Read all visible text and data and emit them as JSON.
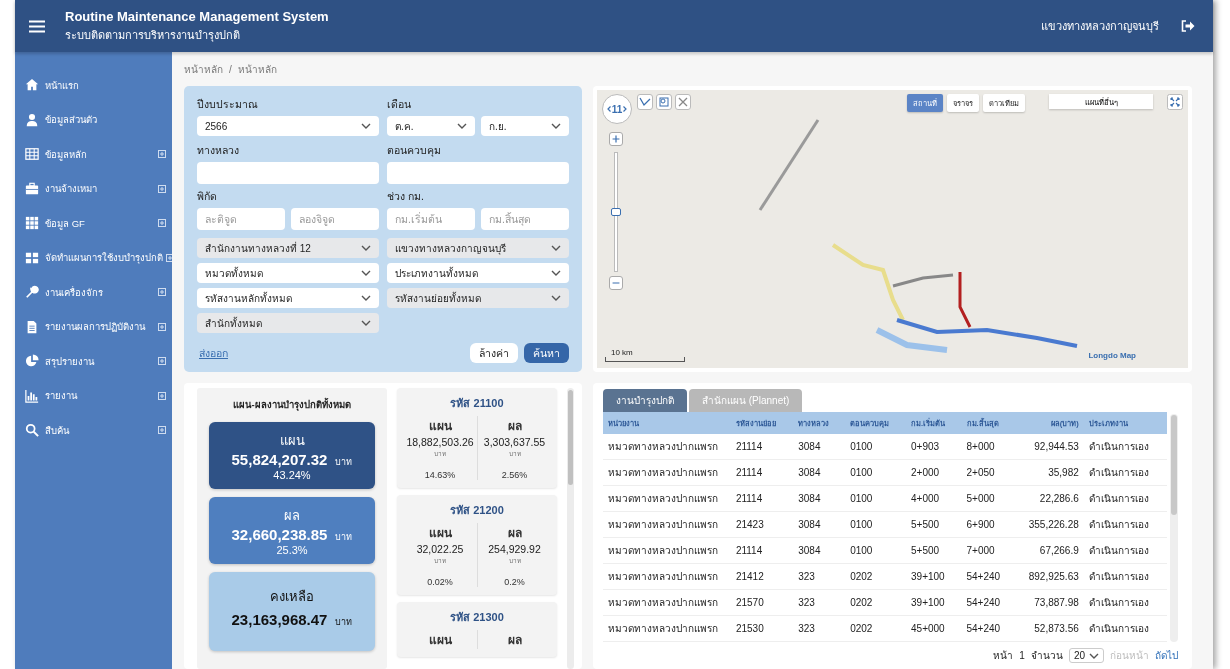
{
  "header": {
    "title": "Routine Maintenance Management System",
    "subtitle": "ระบบติดตามการบริหารงานบำรุงปกติ",
    "user": "แขวงทางหลวงกาญจนบุรี"
  },
  "sidebar": {
    "items": [
      {
        "label": "หน้าแรก",
        "expandable": false
      },
      {
        "label": "ข้อมูลส่วนตัว",
        "expandable": false
      },
      {
        "label": "ข้อมูลหลัก",
        "expandable": true
      },
      {
        "label": "งานจ้างเหมา",
        "expandable": true
      },
      {
        "label": "ข้อมูล GF",
        "expandable": true
      },
      {
        "label": "จัดทำแผนการใช้งบบำรุงปกติ",
        "expandable": true
      },
      {
        "label": "งานเครื่องจักร",
        "expandable": true
      },
      {
        "label": "รายงานผลการปฏิบัติงาน",
        "expandable": true
      },
      {
        "label": "สรุปรายงาน",
        "expandable": true
      },
      {
        "label": "รายงาน",
        "expandable": true
      },
      {
        "label": "สืบค้น",
        "expandable": true
      }
    ]
  },
  "breadcrumb": {
    "items": [
      "หน้าหลัก",
      "หน้าหลัก"
    ],
    "separator": "/"
  },
  "filters": {
    "budget_year": {
      "label": "ปีงบประมาณ",
      "value": "2566"
    },
    "month": {
      "label": "เดือน",
      "from": "ต.ค.",
      "to": "ก.ย."
    },
    "highway": {
      "label": "ทางหลวง"
    },
    "control_section": {
      "label": "ตอนควบคุม"
    },
    "coordinates": {
      "label": "พิกัด",
      "latitude_placeholder": "ละติจูด",
      "longitude_placeholder": "ลองจิจูด"
    },
    "km_range": {
      "label": "ช่วง กม.",
      "start_placeholder": "กม.เริ่มต้น",
      "end_placeholder": "กม.สิ้นสุด"
    },
    "selects": [
      {
        "value": "สำนักงานทางหลวงที่ 12",
        "disabled": true
      },
      {
        "value": "แขวงทางหลวงกาญจนบุรี",
        "disabled": true
      },
      {
        "value": "หมวดทั้งหมด",
        "disabled": false
      },
      {
        "value": "ประเภทงานทั้งหมด",
        "disabled": false
      },
      {
        "value": "รหัสงานหลักทั้งหมด",
        "disabled": false
      },
      {
        "value": "รหัสงานย่อยทั้งหมด",
        "disabled": true
      },
      {
        "value": "สำนักทั้งหมด",
        "disabled": true
      }
    ],
    "export_link": "ส่งออก",
    "clear_button": "ล้างค่า",
    "search_button": "ค้นหา"
  },
  "map": {
    "zoom_level": "11",
    "zoom_slider": {
      "level": 0.5
    },
    "layers": [
      {
        "label": "สถานที่",
        "selected": true
      },
      {
        "label": "จราจร",
        "selected": false
      },
      {
        "label": "ดาวเทียม",
        "selected": false
      }
    ],
    "basemap": "แผนที่อื่นๆ",
    "scale": "10 km",
    "attribution": "Longdo Map"
  },
  "summary": {
    "title": "แผน-ผลงานบำรุงปกติทั้งหมด",
    "cards": [
      {
        "kind": "plan",
        "label": "แผน",
        "amount": "55,824,207.32",
        "unit": "บาท",
        "percent": "43.24%"
      },
      {
        "kind": "result",
        "label": "ผล",
        "amount": "32,660,238.85",
        "unit": "บาท",
        "percent": "25.3%"
      },
      {
        "kind": "remaining",
        "label": "คงเหลือ",
        "amount": "23,163,968.47",
        "unit": "บาท"
      }
    ]
  },
  "code_cards": [
    {
      "title": "รหัส 21100",
      "plan": {
        "label": "แผน",
        "amount": "18,882,503.26",
        "unit": "บาท",
        "percent": "14.63%"
      },
      "result": {
        "label": "ผล",
        "amount": "3,303,637.55",
        "unit": "บาท",
        "percent": "2.56%"
      }
    },
    {
      "title": "รหัส 21200",
      "plan": {
        "label": "แผน",
        "amount": "32,022.25",
        "unit": "บาท",
        "percent": "0.02%"
      },
      "result": {
        "label": "ผล",
        "amount": "254,929.92",
        "unit": "บาท",
        "percent": "0.2%"
      }
    },
    {
      "title": "รหัส 21300",
      "plan": {
        "label": "แผน"
      },
      "result": {
        "label": "ผล"
      }
    }
  ],
  "tabs": [
    {
      "label": "งานบำรุงปกติ",
      "selected": true
    },
    {
      "label": "สำนักแผน (Plannet)",
      "selected": false
    }
  ],
  "table": {
    "columns": [
      "หน่วยงาน",
      "รหัสงานย่อย",
      "ทางหลวง",
      "ตอนควบคุม",
      "กม.เริ่มต้น",
      "กม.สิ้นสุด",
      "ผล(บาท)",
      "ประเภทงาน"
    ],
    "rows": [
      [
        "หมวดทางหลวงปากแพรก",
        "21114",
        "3084",
        "0100",
        "0+903",
        "8+000",
        "92,944.53",
        "ดำเนินการเอง"
      ],
      [
        "หมวดทางหลวงปากแพรก",
        "21114",
        "3084",
        "0100",
        "2+000",
        "2+050",
        "35,982",
        "ดำเนินการเอง"
      ],
      [
        "หมวดทางหลวงปากแพรก",
        "21114",
        "3084",
        "0100",
        "4+000",
        "5+000",
        "22,286.6",
        "ดำเนินการเอง"
      ],
      [
        "หมวดทางหลวงปากแพรก",
        "21423",
        "3084",
        "0100",
        "5+500",
        "6+900",
        "355,226.28",
        "ดำเนินการเอง"
      ],
      [
        "หมวดทางหลวงปากแพรก",
        "21114",
        "3084",
        "0100",
        "5+500",
        "7+000",
        "67,266.9",
        "ดำเนินการเอง"
      ],
      [
        "หมวดทางหลวงปากแพรก",
        "21412",
        "323",
        "0202",
        "39+100",
        "54+240",
        "892,925.63",
        "ดำเนินการเอง"
      ],
      [
        "หมวดทางหลวงปากแพรก",
        "21570",
        "323",
        "0202",
        "39+100",
        "54+240",
        "73,887.98",
        "ดำเนินการเอง"
      ],
      [
        "หมวดทางหลวงปากแพรก",
        "21530",
        "323",
        "0202",
        "45+000",
        "54+240",
        "52,873.56",
        "ดำเนินการเอง"
      ]
    ]
  },
  "pagination": {
    "page_label": "หน้า",
    "page": "1",
    "size_label": "จำนวน",
    "page_size": "20",
    "previous": {
      "label": "ก่อนหน้า",
      "disabled": true
    },
    "next": {
      "label": "ถัดไป",
      "disabled": false
    }
  }
}
